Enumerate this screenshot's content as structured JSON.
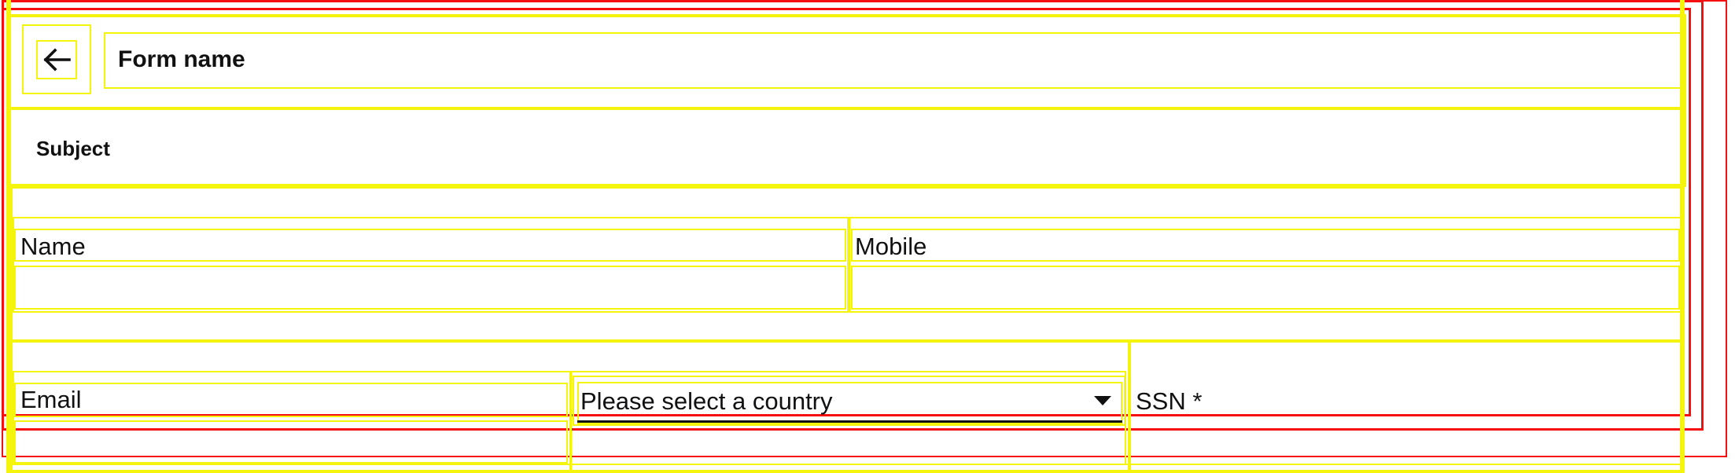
{
  "header": {
    "back_icon": "arrow-left-icon",
    "title": "Form name"
  },
  "form": {
    "subject_label": "Subject",
    "fields": {
      "name_label": "Name",
      "mobile_label": "Mobile",
      "email_label": "Email",
      "country_placeholder": "Please select a country",
      "ssn_label": "SSN *"
    }
  },
  "colors": {
    "outline_primary": "#f41010",
    "outline_secondary": "#f4f40c",
    "text": "#111111"
  }
}
